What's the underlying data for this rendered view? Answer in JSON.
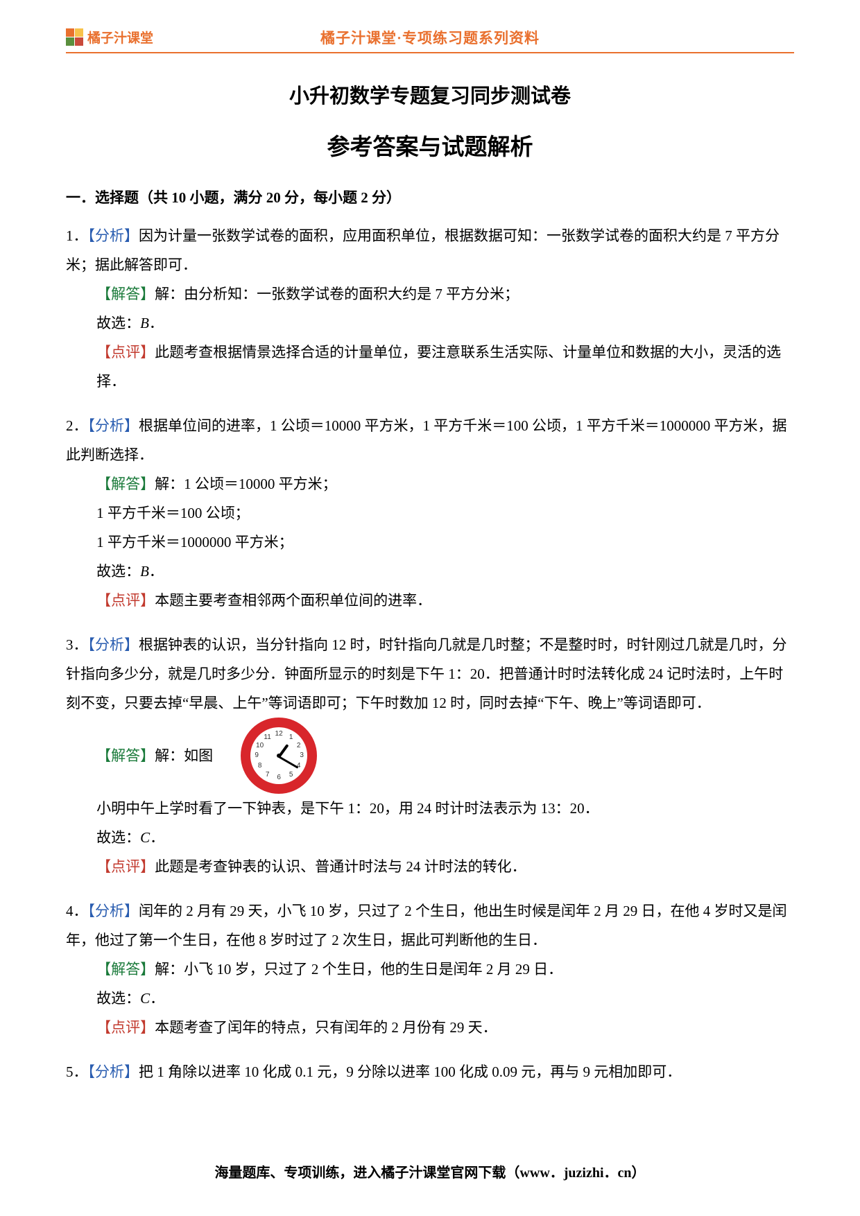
{
  "header": {
    "logo_text": "橘子汁课堂",
    "center": "橘子汁课堂·专项练习题系列资料"
  },
  "title": "小升初数学专题复习同步测试卷",
  "subtitle": "参考答案与试题解析",
  "section1_head": "一．选择题（共 10 小题，满分 20 分，每小题 2 分）",
  "labels": {
    "analysis": "【分析】",
    "answer": "【解答】",
    "comment": "【点评】",
    "answer_prefix": "解：",
    "choice_prefix": "故选：",
    "as_shown": "如图"
  },
  "q1": {
    "num": "1．",
    "analysis": "因为计量一张数学试卷的面积，应用面积单位，根据数据可知：一张数学试卷的面积大约是 7 平方分米；据此解答即可．",
    "answer_line": "由分析知：一张数学试卷的面积大约是 7 平方分米；",
    "choice": "B",
    "comment": "此题考查根据情景选择合适的计量单位，要注意联系生活实际、计量单位和数据的大小，灵活的选择．"
  },
  "q2": {
    "num": "2．",
    "analysis": "根据单位间的进率，1 公顷＝10000 平方米，1 平方千米＝100 公顷，1 平方千米＝1000000 平方米，据此判断选择．",
    "a1": "1 公顷＝10000 平方米；",
    "a2": "1 平方千米＝100 公顷；",
    "a3": "1 平方千米＝1000000 平方米；",
    "choice": "B",
    "comment": "本题主要考查相邻两个面积单位间的进率．"
  },
  "q3": {
    "num": "3．",
    "analysis": "根据钟表的认识，当分针指向 12 时，时针指向几就是几时整；不是整时时，时针刚过几就是几时，分针指向多少分，就是几时多少分．钟面所显示的时刻是下午 1：20．把普通计时时法转化成 24 记时法时，上午时刻不变，只要去掉“早晨、上午”等词语即可；下午时数加 12 时，同时去掉“下午、晚上”等词语即可．",
    "after_img": "小明中午上学时看了一下钟表，是下午 1：20，用 24 时计时法表示为 13：20．",
    "choice": "C",
    "comment": "此题是考查钟表的认识、普通计时法与 24 计时法的转化．",
    "clock_nums": [
      "12",
      "1",
      "2",
      "3",
      "4",
      "5",
      "6",
      "7",
      "8",
      "9",
      "10",
      "11"
    ]
  },
  "q4": {
    "num": "4．",
    "analysis": "闰年的 2 月有 29 天，小飞 10 岁，只过了 2 个生日，他出生时候是闰年 2 月 29 日，在他 4 岁时又是闰年，他过了第一个生日，在他 8 岁时过了 2 次生日，据此可判断他的生日．",
    "answer_line": "小飞 10 岁，只过了 2 个生日，他的生日是闰年 2 月 29 日．",
    "choice": "C",
    "comment": "本题考查了闰年的特点，只有闰年的 2 月份有 29 天．"
  },
  "q5": {
    "num": "5．",
    "analysis": "把 1 角除以进率 10 化成 0.1 元，9 分除以进率 100 化成 0.09 元，再与 9 元相加即可．"
  },
  "footer": "海量题库、专项训练，进入橘子汁课堂官网下载（www．juzizhi．cn）"
}
